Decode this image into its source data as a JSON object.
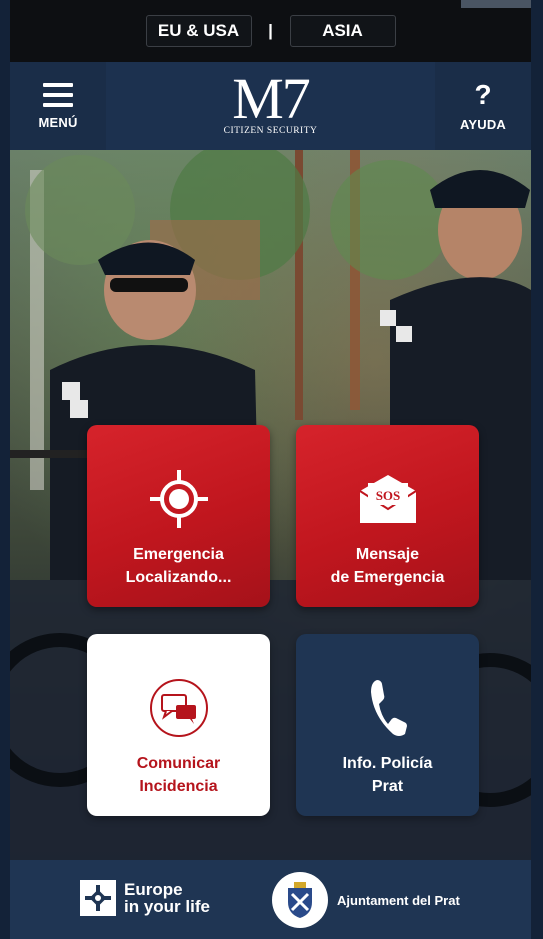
{
  "region": {
    "options": [
      "EU & USA",
      "ASIA"
    ],
    "separator": "|"
  },
  "header": {
    "menu_label": "MENÚ",
    "help_symbol": "?",
    "help_label": "AYUDA",
    "logo_main": "M7",
    "logo_sub": "CITIZEN SECURITY"
  },
  "tiles": [
    {
      "line1": "Emergencia",
      "line2": "Localizando...",
      "icon": "crosshair-icon",
      "style": "red"
    },
    {
      "line1": "Mensaje",
      "line2": "de Emergencia",
      "icon": "sos-envelope-icon",
      "icon_text": "SOS",
      "style": "red"
    },
    {
      "line1": "Comunicar",
      "line2": "Incidencia",
      "icon": "chat-bubbles-icon",
      "style": "white"
    },
    {
      "line1": "Info. Policía",
      "line2": "Prat",
      "icon": "phone-icon",
      "style": "navy"
    }
  ],
  "footer": {
    "eu_line1": "Europe",
    "eu_line2": "in your life",
    "city_label": "Ajuntament del Prat"
  },
  "colors": {
    "accent_red": "#c8161e",
    "navy": "#1f3553",
    "header": "#1c314f"
  }
}
